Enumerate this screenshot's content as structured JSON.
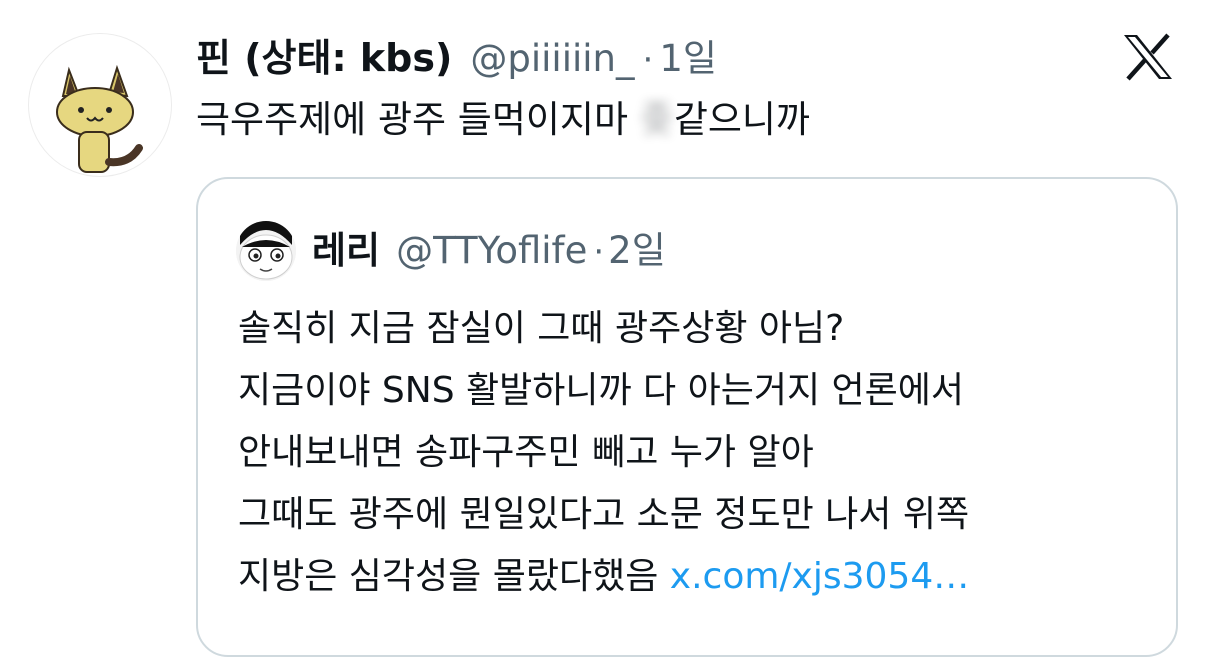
{
  "tweet": {
    "display_name": "핀 (상태: kbs)",
    "handle": "@piiiiiin_",
    "separator": "·",
    "time": "1일",
    "text_before": "극우주제에 광주 들먹이지마 ",
    "text_hidden": "좆",
    "text_after": "같으니까"
  },
  "quote": {
    "display_name": "레리",
    "handle": "@TTYoflife",
    "separator": "·",
    "time": "2일",
    "lines": [
      "솔직히 지금 잠실이 그때 광주상황 아님?",
      "지금이야 SNS 활발하니까 다 아는거지 언론에서",
      "안내보내면 송파구주민 빼고 누가 알아",
      "그때도 광주에 뭔일있다고 소문 정도만 나서 위쪽"
    ],
    "last_line_text": "지방은 심각성을 몰랐다했음 ",
    "link": "x.com/xjs3054…"
  },
  "colors": {
    "text": "#0f1419",
    "secondary": "#536471",
    "link": "#1d9bf0",
    "border": "#cfd9de"
  },
  "icons": {
    "brand": "x-logo-icon",
    "avatar": "cat-avatar",
    "quote_avatar": "face-avatar"
  }
}
